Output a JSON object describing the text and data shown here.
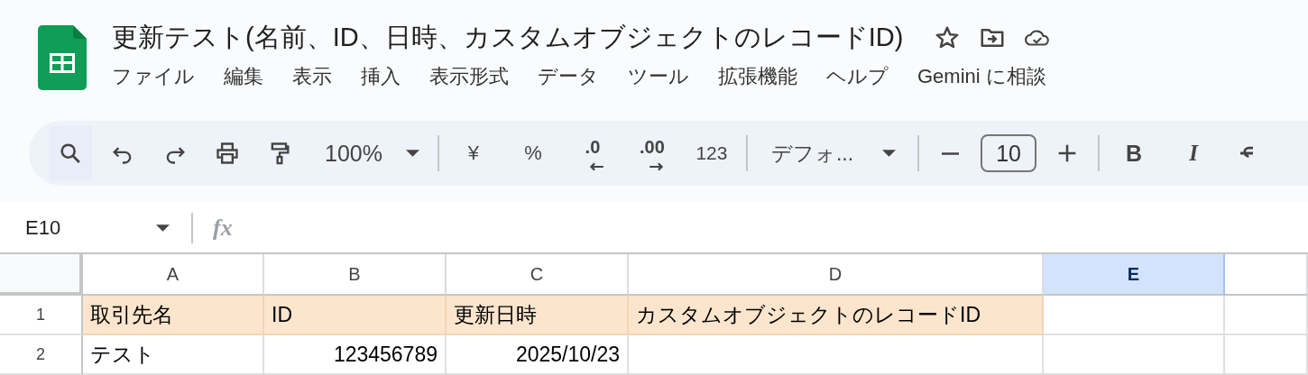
{
  "document": {
    "title": "更新テスト(名前、ID、日時、カスタムオブジェクトのレコードID)"
  },
  "menu": [
    "ファイル",
    "編集",
    "表示",
    "挿入",
    "表示形式",
    "データ",
    "ツール",
    "拡張機能",
    "ヘルプ",
    "Gemini に相談"
  ],
  "toolbar": {
    "zoom": "100%",
    "currency": "¥",
    "percent": "%",
    "decrease_decimal": ".0",
    "increase_decimal": ".00",
    "number_format": "123",
    "font": "デフォ...",
    "font_size": "10",
    "bold": "B",
    "italic": "I"
  },
  "formula_bar": {
    "name_box": "E10",
    "fx": "fx"
  },
  "sheet": {
    "columns": [
      {
        "label": "A",
        "selected": false
      },
      {
        "label": "B",
        "selected": false
      },
      {
        "label": "C",
        "selected": false
      },
      {
        "label": "D",
        "selected": false
      },
      {
        "label": "E",
        "selected": true
      }
    ],
    "rows": [
      {
        "number": "1",
        "highlighted": true,
        "cells": [
          {
            "kind": "text",
            "value": "取引先名"
          },
          {
            "kind": "text",
            "value": "ID"
          },
          {
            "kind": "text",
            "value": "更新日時"
          },
          {
            "kind": "text",
            "value": "カスタムオブジェクトのレコードID"
          },
          {
            "kind": "empty"
          }
        ]
      },
      {
        "number": "2",
        "highlighted": false,
        "cells": [
          {
            "kind": "text",
            "value": "テスト"
          },
          {
            "kind": "number",
            "value": "123456789"
          },
          {
            "kind": "number",
            "value": "2025/10/23"
          },
          {
            "kind": "empty"
          },
          {
            "kind": "empty"
          }
        ]
      }
    ]
  }
}
